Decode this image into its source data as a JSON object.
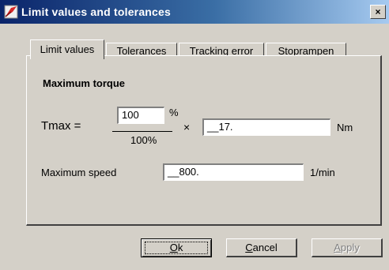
{
  "window": {
    "title": "Limit values and tolerances",
    "close_glyph": "×",
    "icon": "app-icon"
  },
  "tabs": [
    {
      "label": "Limit values",
      "active": true
    },
    {
      "label": "Tolerances",
      "active": false
    },
    {
      "label": "Tracking error",
      "active": false
    },
    {
      "label": "Stoprampen",
      "active": false
    }
  ],
  "max_torque": {
    "group_label": "Maximum torque",
    "formula_label": "Tmax =",
    "numerator_value": "100",
    "numerator_unit": "%",
    "denominator": "100%",
    "times_sign": "×",
    "value": "__17.",
    "unit": "Nm"
  },
  "max_speed": {
    "label": "Maximum speed",
    "value": "__800.",
    "unit": "1/min"
  },
  "buttons": {
    "ok": {
      "accel": "O",
      "rest": "k"
    },
    "cancel": {
      "accel": "C",
      "rest": "ancel"
    },
    "apply": {
      "accel": "A",
      "rest": "pply",
      "disabled": true
    }
  }
}
